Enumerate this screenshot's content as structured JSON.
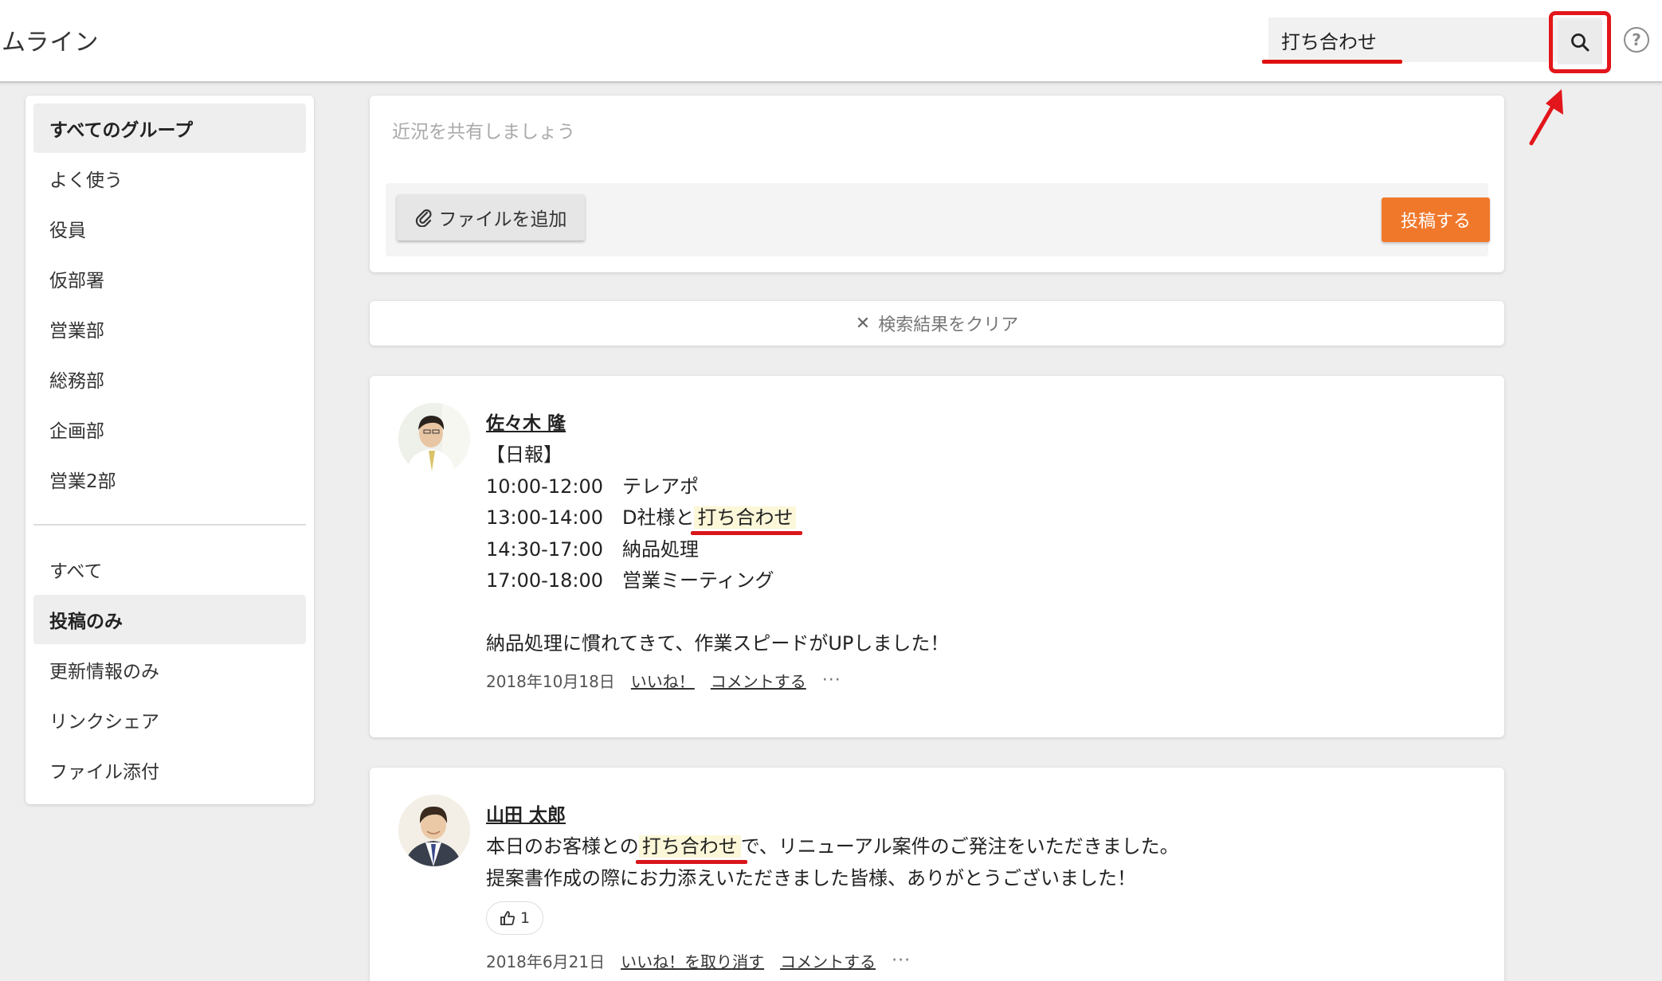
{
  "app": {
    "title": "ムライン"
  },
  "search": {
    "value": "打ち合わせ",
    "icon": "search-icon"
  },
  "help": {
    "icon": "help-icon",
    "glyph": "?"
  },
  "sidebar": {
    "groups": [
      {
        "label": "すべてのグループ",
        "active": true
      },
      {
        "label": "よく使う"
      },
      {
        "label": "役員"
      },
      {
        "label": "仮部署"
      },
      {
        "label": "営業部"
      },
      {
        "label": "総務部"
      },
      {
        "label": "企画部"
      },
      {
        "label": "営業2部"
      }
    ],
    "filters": [
      {
        "label": "すべて"
      },
      {
        "label": "投稿のみ",
        "active": true
      },
      {
        "label": "更新情報のみ"
      },
      {
        "label": "リンクシェア"
      },
      {
        "label": "ファイル添付"
      }
    ]
  },
  "composer": {
    "placeholder": "近況を共有しましょう",
    "file_button": "ファイルを追加",
    "post_button": "投稿する"
  },
  "clear_search": {
    "label": "検索結果をクリア",
    "icon": "close-icon"
  },
  "posts": [
    {
      "author": "佐々木 隆",
      "lines": {
        "l1": "【日報】",
        "l2": "10:00-12:00　テレアポ",
        "l3_pre": "13:00-14:00　D社様と",
        "l3_hl": "打ち合わせ",
        "l4": "14:30-17:00　納品処理",
        "l5": "17:00-18:00　営業ミーティング",
        "l7": "納品処理に慣れてきて、作業スピードがUPしました！"
      },
      "date": "2018年10月18日",
      "like": "いいね！",
      "comment": "コメントする",
      "more": "···"
    },
    {
      "author": "山田 太郎",
      "lines": {
        "l1_pre": "本日のお客様との",
        "l1_hl": "打ち合わせ",
        "l1_post": "で、リニューアル案件のご発注をいただきました。",
        "l2": "提案書作成の際にお力添えいただきました皆様、ありがとうございました！"
      },
      "like_count": "1",
      "date": "2018年6月21日",
      "unlike": "いいね！を取り消す",
      "comment": "コメントする",
      "more": "···"
    }
  ],
  "colors": {
    "accent_orange": "#f0782b",
    "annotation_red": "#e2161b",
    "highlight": "#fbf7d8"
  }
}
